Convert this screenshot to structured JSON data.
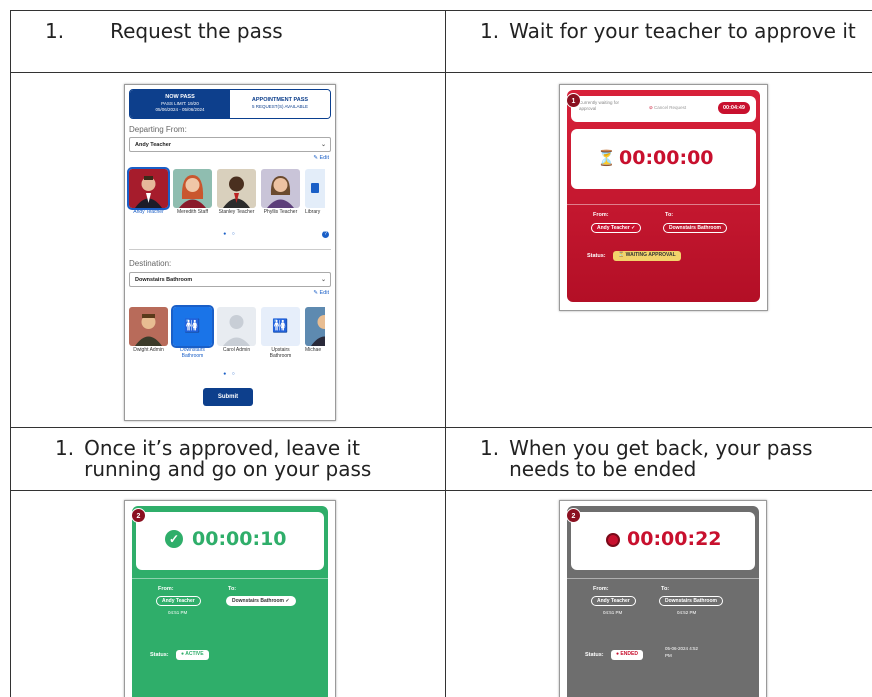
{
  "steps": [
    {
      "num": "1.",
      "text": "Request the pass"
    },
    {
      "num": "1.",
      "text": "Wait for your teacher to approve it"
    },
    {
      "num": "1.",
      "text": "Once it’s approved, leave it running and go on your pass"
    },
    {
      "num": "1.",
      "text": "When you get back, your pass needs to be ended"
    }
  ],
  "request_form": {
    "tab_now": "NOW PASS",
    "tab_now_sub1": "PASS LIMIT: 19/20",
    "tab_now_sub2": "05/06/2024 - 05/06/2024",
    "tab_appt": "APPOINTMENT PASS",
    "tab_appt_sub": "5 REQUEST(S) AVAILABLE",
    "departing_label": "Departing From:",
    "departing_value": "Andy Teacher",
    "edit_label": "Edit",
    "departing_cards": [
      "Andy Teacher",
      "Meredith Staff",
      "Stanley Teacher",
      "Phyllis Teacher",
      "Library"
    ],
    "destination_label": "Destination:",
    "destination_value": "Downstairs Bathroom",
    "destination_cards": [
      "Dwight Admin",
      "Downstairs Bathroom",
      "Carol Admin",
      "Upstairs Bathroom",
      "Michae"
    ],
    "submit_label": "Submit"
  },
  "waiting_card": {
    "badge": "1",
    "waiting_text": "Currently waiting for approval",
    "cancel_label": "Cancel Request",
    "countdown": "00:04:49",
    "timer": "00:00:00",
    "from_label": "From:",
    "to_label": "To:",
    "from_value": "Andy Teacher ✓",
    "to_value": "Downstairs Bathroom",
    "status_label": "Status:",
    "status_value": "WAITING APPROVAL",
    "color": "#c8102e"
  },
  "active_card": {
    "badge": "2",
    "timer": "00:00:10",
    "from_label": "From:",
    "to_label": "To:",
    "from_value": "Andy Teacher",
    "to_value": "Downstairs Bathroom ✓",
    "from_time": "04:51 PM",
    "status_label": "Status:",
    "status_value": "ACTIVE",
    "color": "#2fae6a"
  },
  "ended_card": {
    "badge": "2",
    "timer": "00:00:22",
    "from_label": "From:",
    "to_label": "To:",
    "from_value": "Andy Teacher",
    "to_value": "Downstairs Bathroom",
    "from_time": "04:51 PM",
    "to_time": "04:52 PM",
    "status_label": "Status:",
    "status_value": "ENDED",
    "ended_time": "05-06-2024 4:52 PM",
    "color": "#6e6e6e"
  }
}
